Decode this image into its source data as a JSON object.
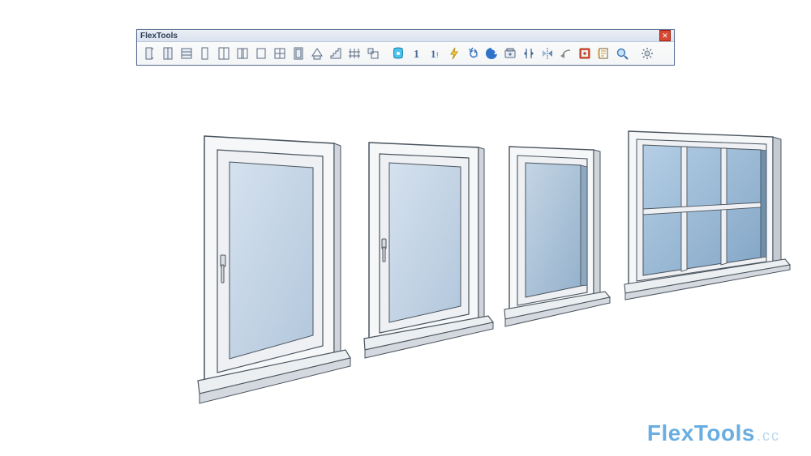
{
  "toolbar": {
    "title": "FlexTools",
    "buttons": [
      {
        "name": "flexdoor-single-icon"
      },
      {
        "name": "flexdoor-double-icon"
      },
      {
        "name": "flexdoor-garage-icon"
      },
      {
        "name": "flexwindow-single-icon"
      },
      {
        "name": "flexwindow-double-icon"
      },
      {
        "name": "flexwindow-sliding-icon"
      },
      {
        "name": "flexwindow-fixed-icon"
      },
      {
        "name": "flexwindow-grid-icon"
      },
      {
        "name": "flexwall-opening-icon"
      },
      {
        "name": "flexskylight-icon"
      },
      {
        "name": "flexstair-icon"
      },
      {
        "name": "flexfence-icon"
      },
      {
        "name": "flexscale-icon"
      },
      {
        "name": "separator"
      },
      {
        "name": "componentfinder-icon"
      },
      {
        "name": "instance-single-icon"
      },
      {
        "name": "instance-multi-icon"
      },
      {
        "name": "zapper-icon"
      },
      {
        "name": "refresh-all-icon"
      },
      {
        "name": "wallcutter-icon"
      },
      {
        "name": "reload-icon"
      },
      {
        "name": "flip-icon"
      },
      {
        "name": "mirror-icon"
      },
      {
        "name": "arrow-left-icon"
      },
      {
        "name": "convert-dynamic-icon"
      },
      {
        "name": "reports-icon"
      },
      {
        "name": "search-icon"
      },
      {
        "name": "separator"
      },
      {
        "name": "settings-icon"
      }
    ]
  },
  "watermark": {
    "bold": "FlexTools",
    "suffix": ".cc"
  },
  "colors": {
    "glass": "#c8d7e6",
    "glassDark": "#9bb6cf",
    "frame": "#dfe4ea",
    "edge": "#3d4a57",
    "sill": "#e6e9ed"
  }
}
